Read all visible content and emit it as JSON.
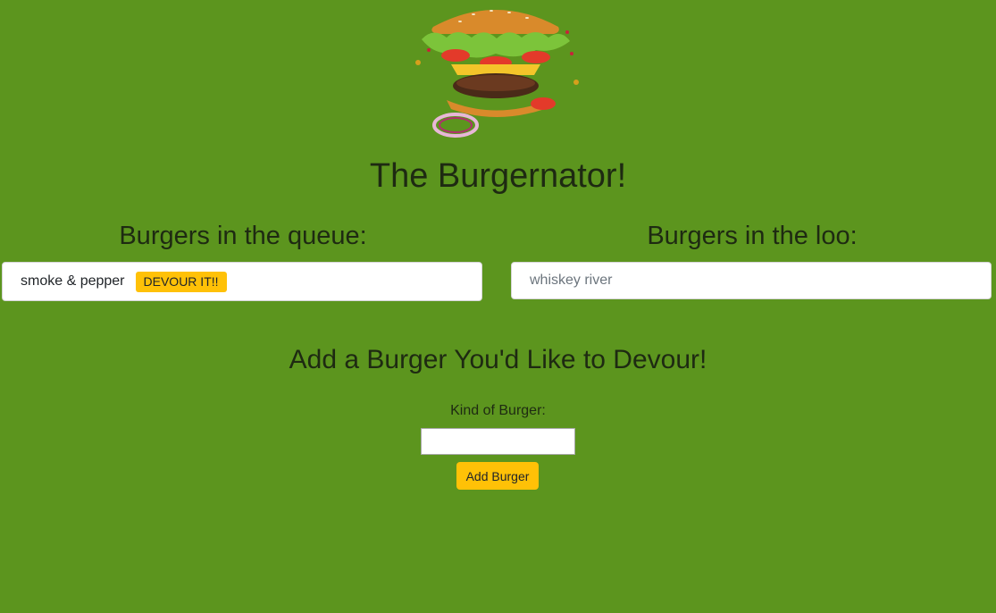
{
  "header": {
    "logo_icon": "exploding-burger-icon",
    "title": "The Burgernator!"
  },
  "queue": {
    "heading": "Burgers in the queue:",
    "items": [
      {
        "name": "smoke & pepper",
        "action_label": "DEVOUR IT!!"
      }
    ]
  },
  "devoured": {
    "heading": "Burgers in the loo:",
    "items": [
      {
        "name": "whiskey river"
      }
    ]
  },
  "add_form": {
    "heading": "Add a Burger You'd Like to Devour!",
    "field_label": "Kind of Burger:",
    "field_value": "",
    "submit_label": "Add Burger"
  },
  "colors": {
    "background": "#5c951e",
    "button": "#ffc107"
  }
}
